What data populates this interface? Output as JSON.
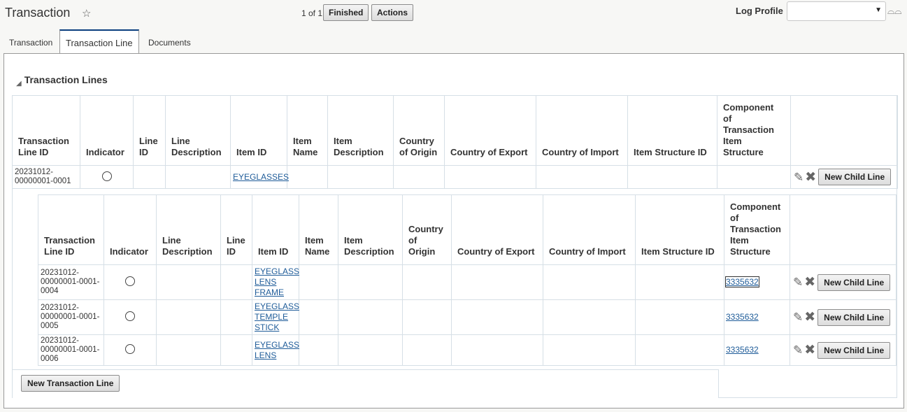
{
  "header": {
    "title": "Transaction",
    "counter": "1 of 1",
    "finished_label": "Finished",
    "actions_label": "Actions",
    "log_profile_label": "Log Profile",
    "log_profile_value": ""
  },
  "tabs": [
    {
      "label": "Transaction",
      "active": false
    },
    {
      "label": "Transaction Line",
      "active": true
    },
    {
      "label": "Documents",
      "active": false
    }
  ],
  "section": {
    "title": "Transaction Lines"
  },
  "parent_table": {
    "columns": [
      "Transaction Line ID",
      "Indicator",
      "Line ID",
      "Line Description",
      "Item ID",
      "Item Name",
      "Item Description",
      "Country of Origin",
      "Country of Export",
      "Country of Import",
      "Item Structure ID",
      "Component of Transaction Item Structure"
    ],
    "row": {
      "line_id": "20231012-00000001-0001",
      "item_id": "EYEGLASSES",
      "new_child_label": "New Child Line"
    }
  },
  "child_table": {
    "columns": [
      "Transaction Line ID",
      "Indicator",
      "Line Description",
      "Line ID",
      "Item ID",
      "Item Name",
      "Item Description",
      "Country of Origin",
      "Country of Export",
      "Country of Import",
      "Item Structure ID",
      "Component of Transaction Item Structure"
    ],
    "rows": [
      {
        "line_id": "20231012-00000001-0001-0004",
        "item_id": "EYEGLASS LENS FRAME",
        "component": "3335632",
        "new_child_label": "New Child Line"
      },
      {
        "line_id": "20231012-00000001-0001-0005",
        "item_id": "EYEGLASS TEMPLE STICK",
        "component": "3335632",
        "new_child_label": "New Child Line"
      },
      {
        "line_id": "20231012-00000001-0001-0006",
        "item_id": "EYEGLASS LENS",
        "component": "3335632",
        "new_child_label": "New Child Line"
      }
    ]
  },
  "footer": {
    "new_line_label": "New Transaction Line"
  },
  "icons": {
    "star": "star-outline-icon",
    "glasses": "glasses-icon",
    "edit": "pencil-icon",
    "delete": "x-icon",
    "collapse": "triangle-icon"
  }
}
